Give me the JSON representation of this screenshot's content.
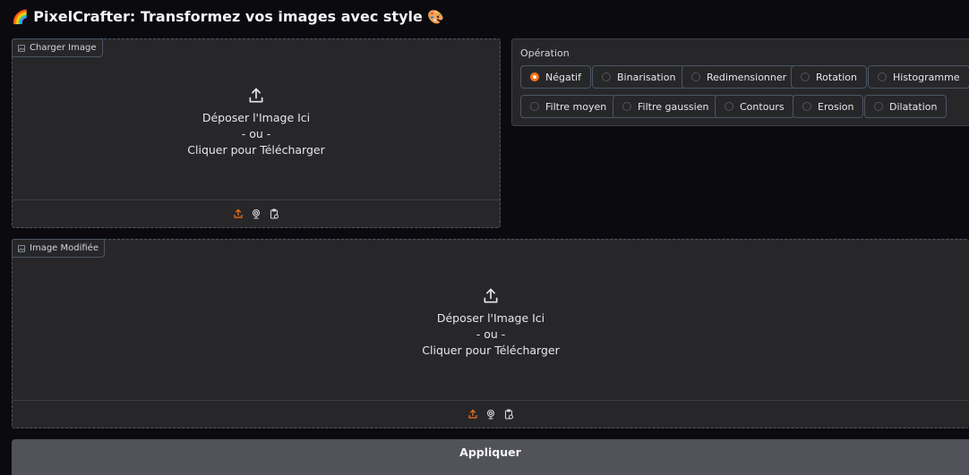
{
  "app": {
    "title_emoji": "🌈",
    "title": "PixelCrafter: Transformez vos images avec style",
    "title_emoji_end": "🎨"
  },
  "upload": {
    "label": "Charger Image",
    "drop_text": "Déposer l'Image Ici",
    "or_text": "- ou -",
    "click_text": "Cliquer pour Télécharger",
    "toolbar_icons": [
      "upload-icon",
      "webcam-icon",
      "clipboard-icon"
    ]
  },
  "modified": {
    "label": "Image Modifiée",
    "drop_text": "Déposer l'Image Ici",
    "or_text": "- ou -",
    "click_text": "Cliquer pour Télécharger",
    "toolbar_icons": [
      "upload-icon",
      "webcam-icon",
      "clipboard-icon"
    ]
  },
  "operation": {
    "label": "Opération",
    "selected": "Négatif",
    "options": [
      "Négatif",
      "Binarisation",
      "Redimensionner",
      "Rotation",
      "Histogramme",
      "Filtre moyen",
      "Filtre gaussien",
      "Contours",
      "Erosion",
      "Dilatation"
    ]
  },
  "apply_button": "Appliquer",
  "colors": {
    "accent": "#f97316",
    "background": "#0b0b0f",
    "panel": "#27272a",
    "button": "#52525b"
  }
}
